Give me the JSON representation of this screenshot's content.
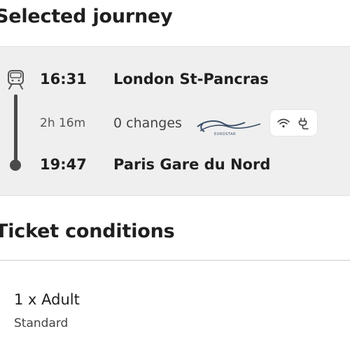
{
  "journey_section": {
    "title": "Selected journey",
    "departure": {
      "time": "16:31",
      "station": "London St-Pancras"
    },
    "arrival": {
      "time": "19:47",
      "station": "Paris Gare du Nord"
    },
    "duration": "2h 16m",
    "changes": "0 changes",
    "operator_logo": {
      "icon": "eurostar-logo",
      "text": "EUROSTAR"
    },
    "amenities": [
      "wifi-icon",
      "power-plug-icon"
    ],
    "mode_icon": "train-icon"
  },
  "ticket_section": {
    "title": "Ticket conditions",
    "passenger": "1 x Adult",
    "fare_class": "Standard"
  }
}
